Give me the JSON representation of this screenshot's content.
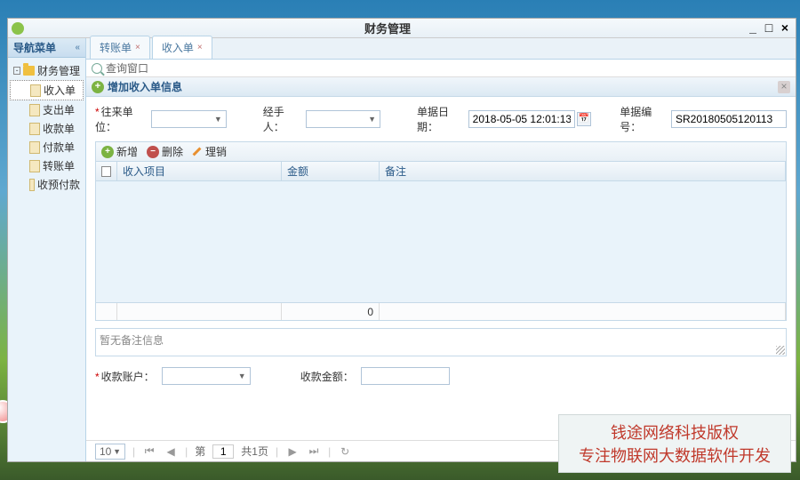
{
  "window": {
    "title": "财务管理"
  },
  "sidebar": {
    "header": "导航菜单",
    "root": "财务管理",
    "items": [
      "收入单",
      "支出单",
      "收款单",
      "付款单",
      "转账单",
      "收预付款"
    ]
  },
  "tabs": [
    {
      "label": "转账单"
    },
    {
      "label": "收入单"
    }
  ],
  "search": {
    "placeholder": "查询窗口"
  },
  "panel": {
    "title": "增加收入单信息"
  },
  "form": {
    "unit_label": "往来单位：",
    "handler_label": "经手人：",
    "date_label": "单据日期：",
    "date_value": "2018-05-05 12:01:13",
    "docno_label": "单据编号：",
    "docno_value": "SR20180505120113",
    "account_label": "收款账户：",
    "amount_label": "收款金额："
  },
  "toolbar": {
    "add": "新增",
    "del": "删除",
    "edit": "理销"
  },
  "grid": {
    "cols": [
      "收入项目",
      "金额",
      "备注"
    ],
    "total": "0"
  },
  "remark_placeholder": "暂无备注信息",
  "pager": {
    "size": "10",
    "page_lbl": "第",
    "page": "1",
    "total": "共1页"
  },
  "banner": {
    "line1": "钱途网络科技版权",
    "line2": "专注物联网大数据软件开发"
  }
}
